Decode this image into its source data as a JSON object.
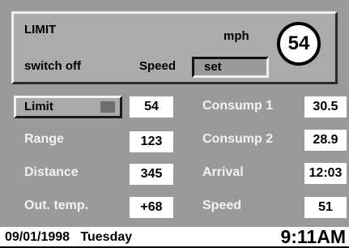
{
  "header": {
    "limit_label": "LIMIT",
    "switch_label": "switch off",
    "unit_label": "mph",
    "speed_label": "Speed",
    "set_button_label": "set",
    "current_speed": "54"
  },
  "left_rows": [
    {
      "label": "Limit",
      "value": "54"
    },
    {
      "label": "Range",
      "value": "123"
    },
    {
      "label": "Distance",
      "value": "345"
    },
    {
      "label": "Out. temp.",
      "value": "+68"
    }
  ],
  "right_rows": [
    {
      "label": "Consump 1",
      "value": "30.5"
    },
    {
      "label": "Consump 2",
      "value": "28.9"
    },
    {
      "label": "Arrival",
      "value": "12:03"
    },
    {
      "label": "Speed",
      "value": "51"
    }
  ],
  "status": {
    "date": "09/01/1998",
    "weekday": "Tuesday",
    "time": "9:11AM"
  },
  "colors": {
    "background": "#9a9a9a",
    "panel": "#ababab",
    "value_box": "#ffffff",
    "light_text": "#f2f2f2"
  }
}
